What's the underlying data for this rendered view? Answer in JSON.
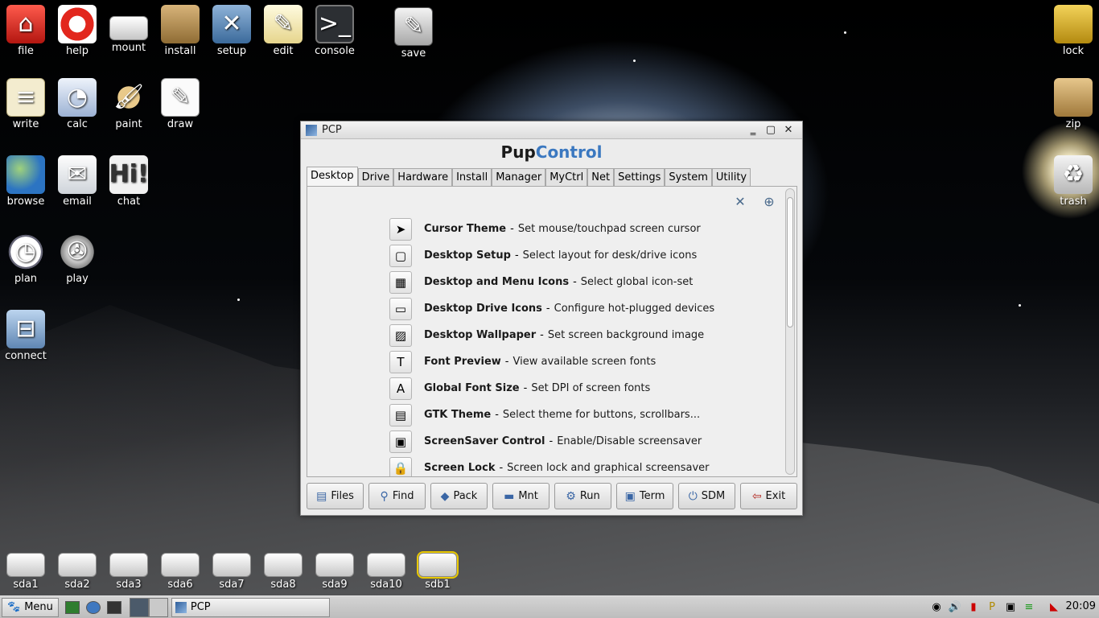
{
  "desktop": {
    "icons_left": [
      {
        "label": "file",
        "icon": "file-manager-icon"
      },
      {
        "label": "help",
        "icon": "help-lifebuoy-icon"
      },
      {
        "label": "mount",
        "icon": "drive-icon"
      },
      {
        "label": "install",
        "icon": "package-box-icon"
      },
      {
        "label": "setup",
        "icon": "setup-tools-icon"
      },
      {
        "label": "edit",
        "icon": "notepad-pencil-icon"
      },
      {
        "label": "console",
        "icon": "terminal-icon"
      },
      {
        "label": "save",
        "icon": "save-icon"
      },
      {
        "label": "write",
        "icon": "document-icon"
      },
      {
        "label": "calc",
        "icon": "spreadsheet-icon"
      },
      {
        "label": "paint",
        "icon": "palette-icon"
      },
      {
        "label": "draw",
        "icon": "drawing-icon"
      },
      {
        "label": "browse",
        "icon": "globe-icon"
      },
      {
        "label": "email",
        "icon": "envelope-icon"
      },
      {
        "label": "chat",
        "icon": "chat-bubble-icon",
        "glyph": "Hi!"
      },
      {
        "label": "plan",
        "icon": "clock-icon"
      },
      {
        "label": "play",
        "icon": "film-reel-icon"
      },
      {
        "label": "connect",
        "icon": "network-icon"
      }
    ],
    "icons_right": [
      {
        "label": "lock",
        "icon": "padlock-icon"
      },
      {
        "label": "zip",
        "icon": "archive-box-icon"
      },
      {
        "label": "trash",
        "icon": "trash-can-icon"
      }
    ],
    "drives": [
      "sda1",
      "sda2",
      "sda3",
      "sda6",
      "sda7",
      "sda8",
      "sda9",
      "sda10",
      "sdb1"
    ]
  },
  "window": {
    "title": "PCP",
    "brand_part1": "Pup",
    "brand_part2": "Control",
    "tabs": [
      "Desktop",
      "Drive",
      "Hardware",
      "Install",
      "Manager",
      "MyCtrl",
      "Net",
      "Settings",
      "System",
      "Utility"
    ],
    "active_tab": "Desktop",
    "items": [
      {
        "name": "Cursor Theme",
        "desc": "Set mouse/touchpad screen cursor",
        "icon": "cursor-arrow-icon"
      },
      {
        "name": "Desktop Setup",
        "desc": "Select layout for desk/drive icons",
        "icon": "desktop-setup-icon"
      },
      {
        "name": "Desktop and Menu Icons",
        "desc": "Select global icon-set",
        "icon": "icon-grid-icon"
      },
      {
        "name": "Desktop Drive Icons",
        "desc": "Configure hot-plugged devices",
        "icon": "drive-icon"
      },
      {
        "name": "Desktop Wallpaper",
        "desc": "Set screen background image",
        "icon": "wallpaper-icon"
      },
      {
        "name": "Font Preview",
        "desc": "View available screen fonts",
        "icon": "font-preview-icon"
      },
      {
        "name": "Global Font Size",
        "desc": "Set DPI of screen fonts",
        "icon": "font-size-icon"
      },
      {
        "name": "GTK Theme",
        "desc": "Select theme for buttons, scrollbars...",
        "icon": "gtk-theme-icon"
      },
      {
        "name": "ScreenSaver Control",
        "desc": "Enable/Disable screensaver",
        "icon": "monitor-icon"
      },
      {
        "name": "Screen Lock",
        "desc": "Screen lock and graphical screensaver",
        "icon": "padlock-icon"
      }
    ],
    "separator": "-",
    "buttons": [
      {
        "label": "Files",
        "icon": "files-icon"
      },
      {
        "label": "Find",
        "icon": "magnifier-icon"
      },
      {
        "label": "Pack",
        "icon": "package-cube-icon"
      },
      {
        "label": "Mnt",
        "icon": "mount-drive-icon"
      },
      {
        "label": "Run",
        "icon": "gear-run-icon"
      },
      {
        "label": "Term",
        "icon": "terminal-icon"
      },
      {
        "label": "SDM",
        "icon": "power-icon"
      },
      {
        "label": "Exit",
        "icon": "exit-door-icon"
      }
    ]
  },
  "taskbar": {
    "menu_label": "Menu",
    "task_label": "PCP",
    "clock": "20:09"
  },
  "colors": {
    "brand_accent": "#3b78c0",
    "selected_drive_outline": "#e8c800"
  }
}
